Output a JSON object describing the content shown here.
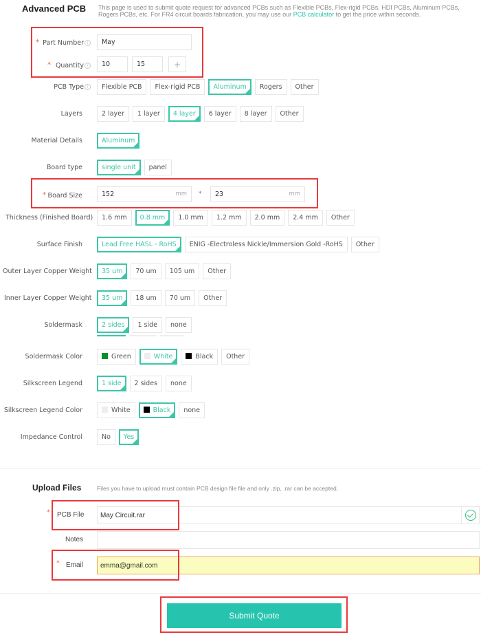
{
  "section1": {
    "title": "Advanced PCB",
    "intro_before_link": "This page is used to submit quote request for advanced PCBs such as Flexible PCBs, Flex-rigid PCBs, HDI PCBs, Aluminum PCBs, Rogers PCBs, etc. For FR4 circuit boards fabrication, you may use our ",
    "intro_link": "PCB calculator",
    "intro_after_link": " to get the price within seconds."
  },
  "part_number": {
    "label": "Part Number",
    "required": "*",
    "value": "May"
  },
  "quantity": {
    "label": "Quantity",
    "required": "*",
    "value1": "10",
    "value2": "15",
    "add_label": "+"
  },
  "pcb_type": {
    "label": "PCB Type",
    "options": [
      "Flexible PCB",
      "Flex-rigid PCB",
      "Aluminum",
      "Rogers",
      "Other"
    ],
    "selected": "Aluminum"
  },
  "layers": {
    "label": "Layers",
    "options": [
      "2 layer",
      "1 layer",
      "4 layer",
      "6 layer",
      "8 layer",
      "Other"
    ],
    "selected": "4 layer"
  },
  "material_details": {
    "label": "Material Details",
    "options": [
      "Aluminum"
    ],
    "selected": "Aluminum"
  },
  "board_type": {
    "label": "Board type",
    "options": [
      "single unit",
      "panel"
    ],
    "selected": "single unit"
  },
  "board_size": {
    "label": "Board Size",
    "required": "*",
    "width": "152",
    "height": "23",
    "unit": "mm",
    "separator": "*"
  },
  "thickness": {
    "label": "Thickness (Finished Board)",
    "options": [
      "1.6 mm",
      "0.8 mm",
      "1.0 mm",
      "1.2 mm",
      "2.0 mm",
      "2.4 mm",
      "Other"
    ],
    "selected": "0.8 mm"
  },
  "surface_finish": {
    "label": "Surface Finish",
    "options": [
      "Lead Free HASL - RoHS",
      "ENIG -Electroless Nickle/Immersion Gold -RoHS",
      "Other"
    ],
    "selected": "Lead Free HASL - RoHS"
  },
  "outer_copper": {
    "label": "Outer Layer Copper Weight",
    "options": [
      "35 um",
      "70 um",
      "105 um",
      "Other"
    ],
    "selected": "35 um"
  },
  "inner_copper": {
    "label": "Inner Layer Copper Weight",
    "options": [
      "35 um",
      "18 um",
      "70 um",
      "Other"
    ],
    "selected": "35 um"
  },
  "soldermask": {
    "label": "Soldermask",
    "options": [
      "2 sides",
      "1 side",
      "none"
    ],
    "selected": "2 sides"
  },
  "soldermask_color": {
    "label": "Soldermask Color",
    "options": [
      {
        "label": "Green",
        "swatch": "#0a8f2f"
      },
      {
        "label": "White",
        "swatch": "#eeeeee"
      },
      {
        "label": "Black",
        "swatch": "#000000"
      },
      {
        "label": "Other",
        "swatch": null
      }
    ],
    "selected": "White"
  },
  "silkscreen": {
    "label": "Silkscreen Legend",
    "options": [
      "1 side",
      "2 sides",
      "none"
    ],
    "selected": "1 side"
  },
  "silkscreen_color": {
    "label": "Silkscreen Legend Color",
    "options": [
      {
        "label": "White",
        "swatch": "#eeeeee"
      },
      {
        "label": "Black",
        "swatch": "#000000"
      },
      {
        "label": "none",
        "swatch": null
      }
    ],
    "selected": "Black"
  },
  "impedance": {
    "label": "Impedance Control",
    "options": [
      "No",
      "Yes"
    ],
    "selected": "Yes"
  },
  "section2": {
    "title": "Upload Files",
    "intro": "Files you have to upload must contain PCB design file file and only .zip, .rar can be accepted."
  },
  "pcb_file": {
    "label": "PCB File",
    "required": "*",
    "value": "May Circuit.rar",
    "status_icon": "check-circle-icon"
  },
  "notes": {
    "label": "Notes",
    "value": ""
  },
  "email": {
    "label": "Email",
    "required": "*",
    "value": "emma@gmail.com"
  },
  "submit": {
    "label": "Submit Quote"
  },
  "colors": {
    "accent": "#3cc6a8",
    "button": "#26c4af",
    "required": "#f05a2a",
    "highlight_box": "#e8393c",
    "email_bg": "#fbfdc0",
    "email_border": "#f5a05a"
  }
}
